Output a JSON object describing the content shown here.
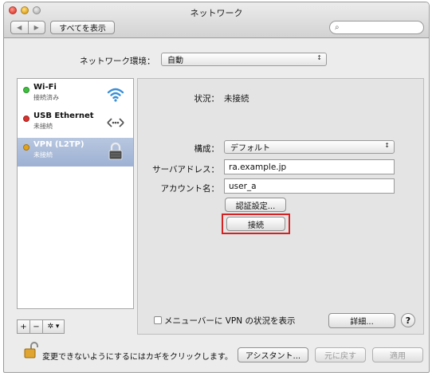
{
  "window": {
    "title": "ネットワーク",
    "nav_back": "◀",
    "nav_forward": "▶",
    "show_all": "すべてを表示",
    "search_placeholder": ""
  },
  "location": {
    "label": "ネットワーク環境：",
    "value": "自動"
  },
  "services": [
    {
      "name": "Wi-Fi",
      "status": "接続済み",
      "status_color": "#3fbf3f",
      "icon": "wifi-icon",
      "selected": false
    },
    {
      "name": "USB Ethernet",
      "status": "未接続",
      "status_color": "#d9322d",
      "icon": "ethernet-icon",
      "selected": false
    },
    {
      "name": "VPN (L2TP)",
      "status": "未接続",
      "status_color": "#e2a21c",
      "icon": "vpn-lock-icon",
      "selected": true
    }
  ],
  "sidebar_footer": {
    "add": "+",
    "remove": "−",
    "action": "✲ ▾"
  },
  "detail": {
    "status_label": "状況：",
    "status_value": "未接続",
    "config_label": "構成：",
    "config_value": "デフォルト",
    "server_label": "サーバアドレス：",
    "server_value": "ra.example.jp",
    "account_label": "アカウント名：",
    "account_value": "user_a",
    "auth_button": "認証設定...",
    "connect_button": "接続",
    "show_vpn_menu": "メニューバーに VPN の状況を表示",
    "show_vpn_menu_checked": false,
    "advanced_button": "詳細...",
    "help": "?"
  },
  "footer": {
    "lock_message": "変更できないようにするにはカギをクリックします。",
    "assistant_button": "アシスタント...",
    "revert_button": "元に戻す",
    "apply_button": "適用"
  },
  "colors": {
    "selection": "#9db1d3",
    "highlight_box": "#d42222"
  }
}
